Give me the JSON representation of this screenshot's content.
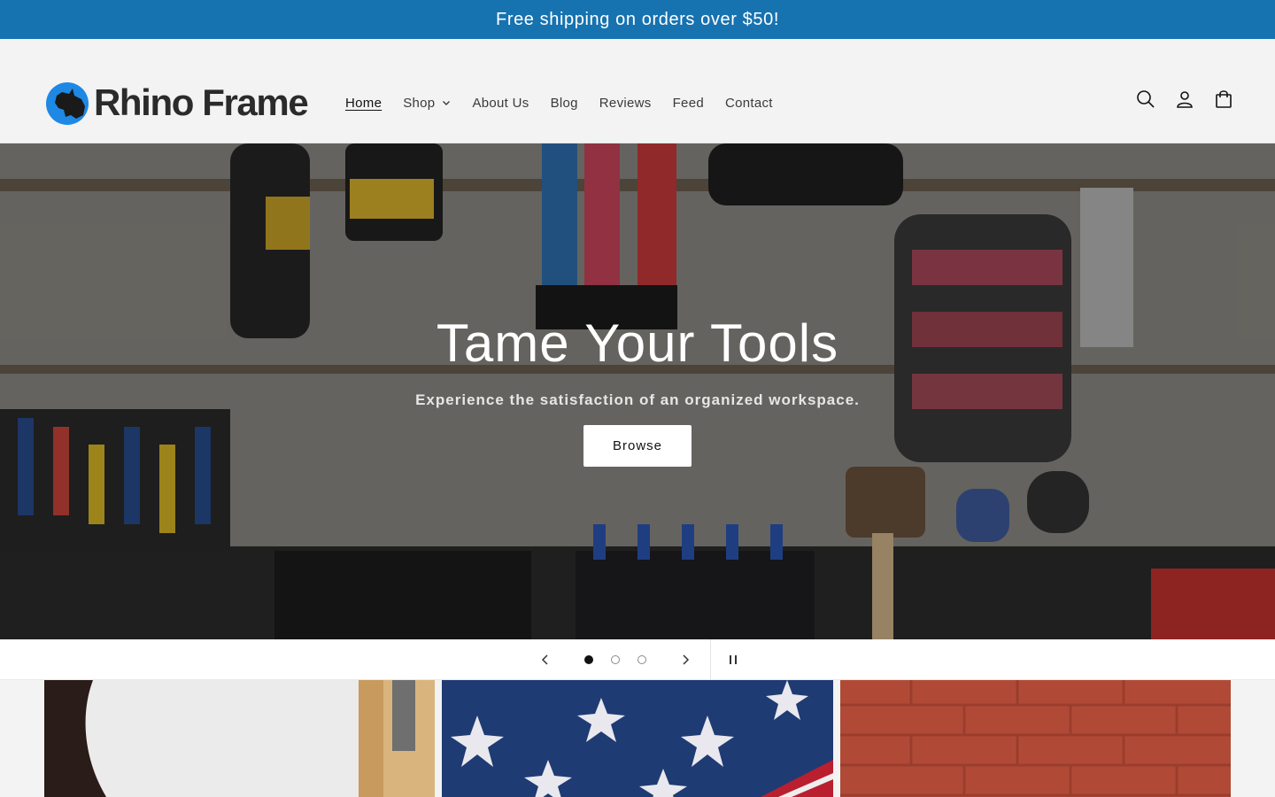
{
  "announcement": {
    "text": "Free shipping on orders over $50!"
  },
  "brand": {
    "name": "Rhino Frame",
    "colors": {
      "accent": "#1772b0",
      "logo_blue": "#1e88e5",
      "text": "#2b2b2b"
    }
  },
  "nav": {
    "items": [
      {
        "label": "Home",
        "active": true
      },
      {
        "label": "Shop",
        "has_dropdown": true
      },
      {
        "label": "About Us"
      },
      {
        "label": "Blog"
      },
      {
        "label": "Reviews"
      },
      {
        "label": "Feed"
      },
      {
        "label": "Contact"
      }
    ]
  },
  "header_icons": [
    "search-icon",
    "account-icon",
    "cart-icon"
  ],
  "hero": {
    "title": "Tame Your Tools",
    "subtitle": "Experience the satisfaction of an organized workspace.",
    "button_label": "Browse"
  },
  "slider": {
    "slides": 3,
    "current": 1,
    "prev_icon": "chevron-left-icon",
    "next_icon": "chevron-right-icon",
    "pause_icon": "pause-icon"
  },
  "collection_tiles": [
    {
      "name": "tile-white-wall"
    },
    {
      "name": "tile-american-flag"
    },
    {
      "name": "tile-brick-wall"
    }
  ]
}
